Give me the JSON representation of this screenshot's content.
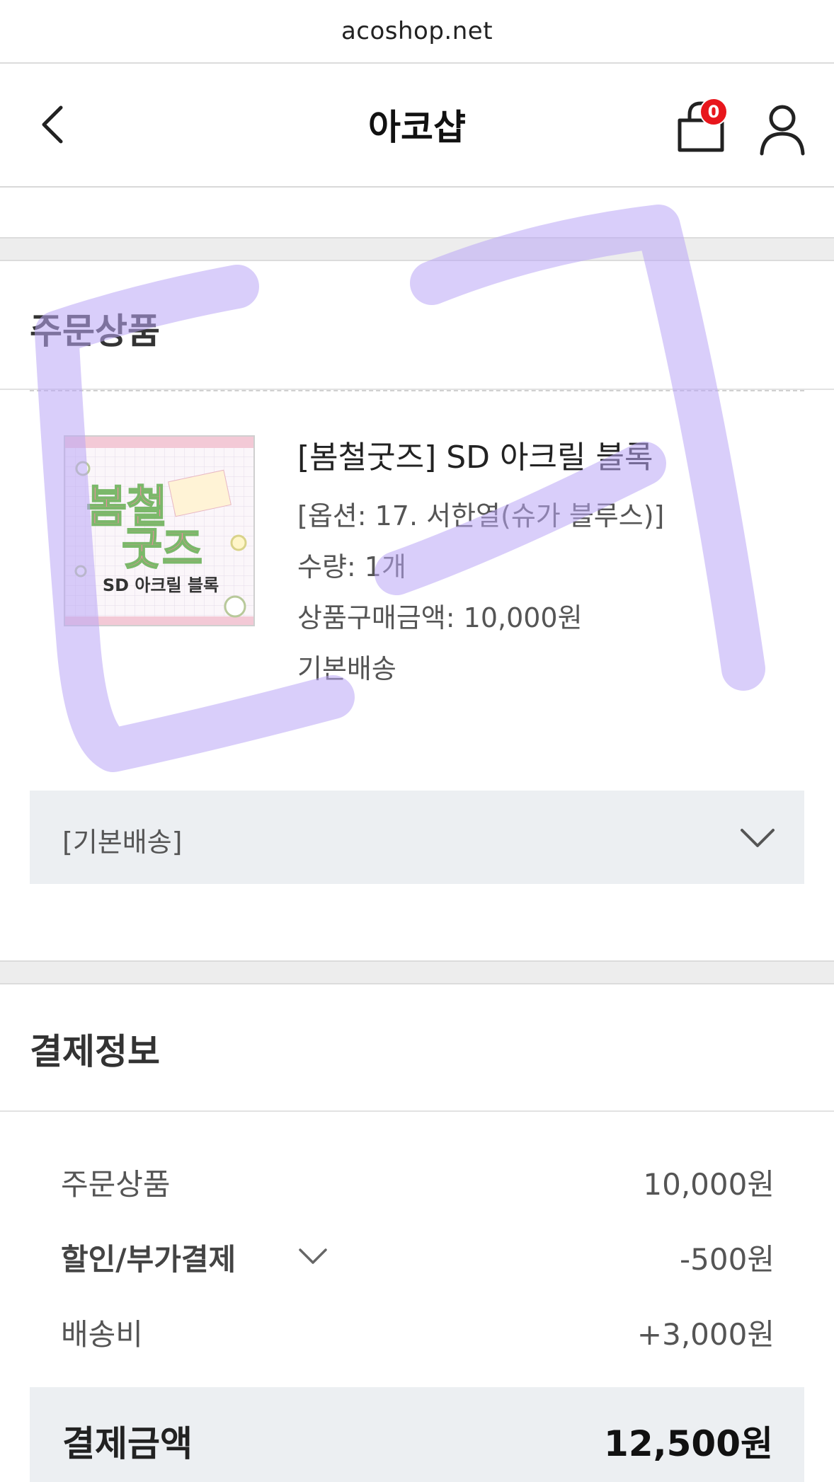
{
  "browser": {
    "url": "acoshop.net"
  },
  "header": {
    "title": "아코샵",
    "cart_count": "0"
  },
  "order": {
    "section_title": "주문상품",
    "product": {
      "name": "[봄철굿즈] SD 아크릴 블록",
      "option": "[옵션: 17. 서한열(슈가 블루스)]",
      "quantity": "수량: 1개",
      "price": "상품구매금액: 10,000원",
      "shipping": "기본배송",
      "thumb_title_line1": "봄철",
      "thumb_title_line2": "굿즈",
      "thumb_subtitle": "SD 아크릴 블록"
    },
    "shipping_dropdown_label": "[기본배송]"
  },
  "payment": {
    "section_title": "결제정보",
    "rows": [
      {
        "label": "주문상품",
        "value": "10,000원"
      },
      {
        "label": "할인/부가결제",
        "value": "-500원"
      },
      {
        "label": "배송비",
        "value": "+3,000원"
      }
    ],
    "total_label": "결제금액",
    "total_value": "12,500원"
  },
  "colors": {
    "badge": "#e8161c",
    "highlighter": "#b9a6f5",
    "dropdown_bg": "#eceff2",
    "band_bg": "#ededed"
  }
}
